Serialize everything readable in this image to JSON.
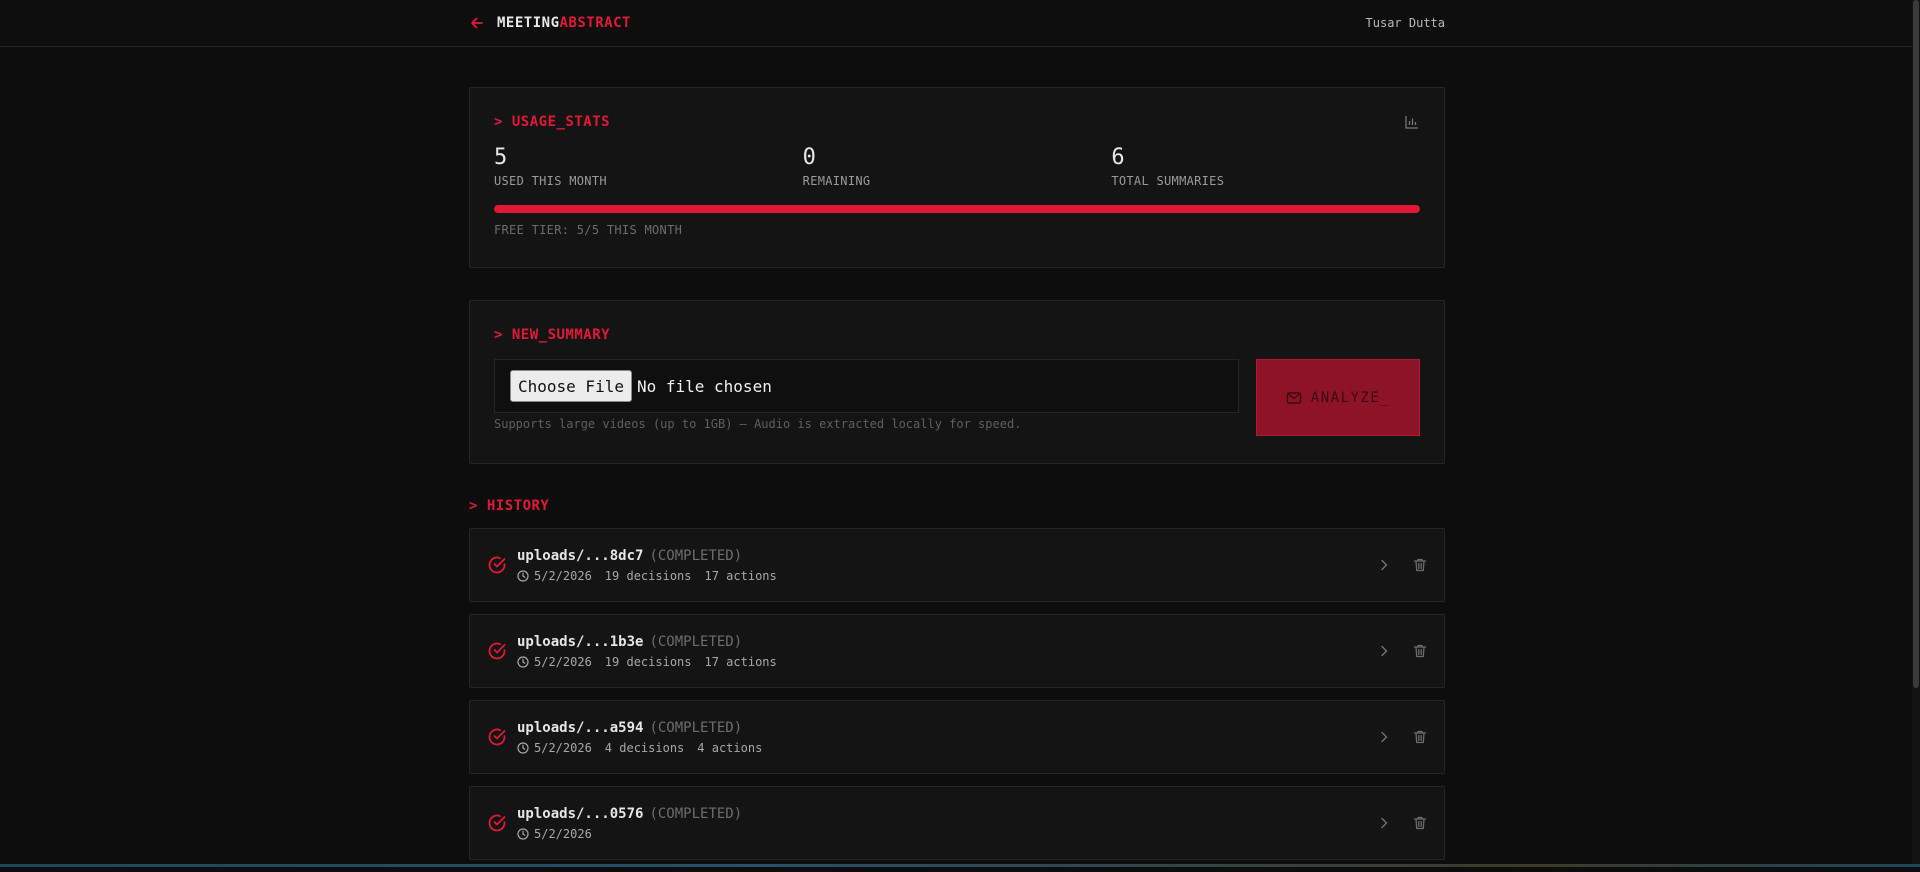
{
  "header": {
    "logo_part1": "MEETING",
    "logo_part2": "ABSTRACT",
    "user_name": "Tusar Dutta"
  },
  "usage": {
    "title": "> USAGE_STATS",
    "stats": [
      {
        "value": "5",
        "label": "USED THIS MONTH"
      },
      {
        "value": "0",
        "label": "REMAINING"
      },
      {
        "value": "6",
        "label": "TOTAL SUMMARIES"
      }
    ],
    "progress_percent": 100,
    "tier_text": "FREE TIER: 5/5 THIS MONTH"
  },
  "new_summary": {
    "title": "> NEW_SUMMARY",
    "choose_label": "Choose File",
    "file_status": "No file chosen",
    "analyze_label": "ANALYZE_",
    "help_text": "Supports large videos (up to 1GB) — Audio is extracted locally for speed."
  },
  "history": {
    "title": "> HISTORY",
    "items": [
      {
        "name": "uploads/...8dc7",
        "status": "(COMPLETED)",
        "date": "5/2/2026",
        "decisions": "19 decisions",
        "actions": "17 actions"
      },
      {
        "name": "uploads/...1b3e",
        "status": "(COMPLETED)",
        "date": "5/2/2026",
        "decisions": "19 decisions",
        "actions": "17 actions"
      },
      {
        "name": "uploads/...a594",
        "status": "(COMPLETED)",
        "date": "5/2/2026",
        "decisions": "4 decisions",
        "actions": "4 actions"
      },
      {
        "name": "uploads/...0576",
        "status": "(COMPLETED)",
        "date": "5/2/2026",
        "decisions": "",
        "actions": ""
      }
    ]
  },
  "colors": {
    "accent": "#e31837",
    "background": "#0d0d0e",
    "card": "#141415"
  }
}
